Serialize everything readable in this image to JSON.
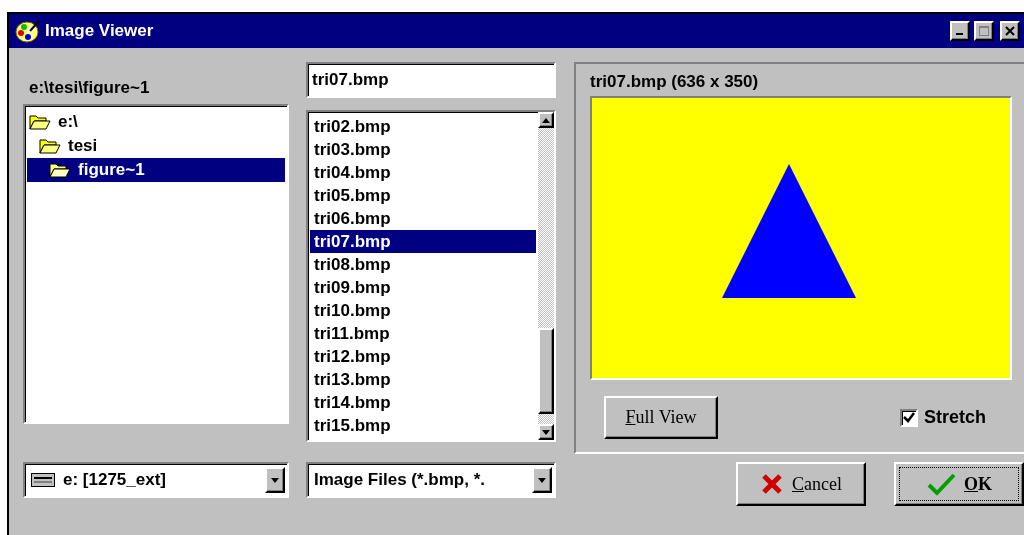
{
  "window": {
    "title": "Image Viewer"
  },
  "directory": {
    "path": "e:\\tesi\\figure~1"
  },
  "folder_tree": [
    {
      "label": "e:\\",
      "selected": false,
      "children": [
        {
          "label": "tesi",
          "selected": false,
          "children": [
            {
              "label": "figure~1",
              "selected": true
            }
          ]
        }
      ]
    }
  ],
  "file_name": {
    "value": "tri07.bmp"
  },
  "files": [
    {
      "name": "tri02.bmp",
      "selected": false
    },
    {
      "name": "tri03.bmp",
      "selected": false
    },
    {
      "name": "tri04.bmp",
      "selected": false
    },
    {
      "name": "tri05.bmp",
      "selected": false
    },
    {
      "name": "tri06.bmp",
      "selected": false
    },
    {
      "name": "tri07.bmp",
      "selected": true
    },
    {
      "name": "tri08.bmp",
      "selected": false
    },
    {
      "name": "tri09.bmp",
      "selected": false
    },
    {
      "name": "tri10.bmp",
      "selected": false
    },
    {
      "name": "tri11.bmp",
      "selected": false
    },
    {
      "name": "tri12.bmp",
      "selected": false
    },
    {
      "name": "tri13.bmp",
      "selected": false
    },
    {
      "name": "tri14.bmp",
      "selected": false
    },
    {
      "name": "tri15.bmp",
      "selected": false
    }
  ],
  "drive": {
    "value": "e: [1275_ext]"
  },
  "file_type": {
    "value": "Image Files (*.bmp, *."
  },
  "preview": {
    "caption": "tri07.bmp (636 x 350)",
    "kind": "picture"
  },
  "full_view_button": "Full View",
  "stretch": {
    "label": "Stretch",
    "checked": true
  },
  "buttons": [
    {
      "kind": "cancel",
      "label": "Cancel",
      "focused": false
    },
    {
      "kind": "ok",
      "label": "OK",
      "focused": true
    }
  ]
}
